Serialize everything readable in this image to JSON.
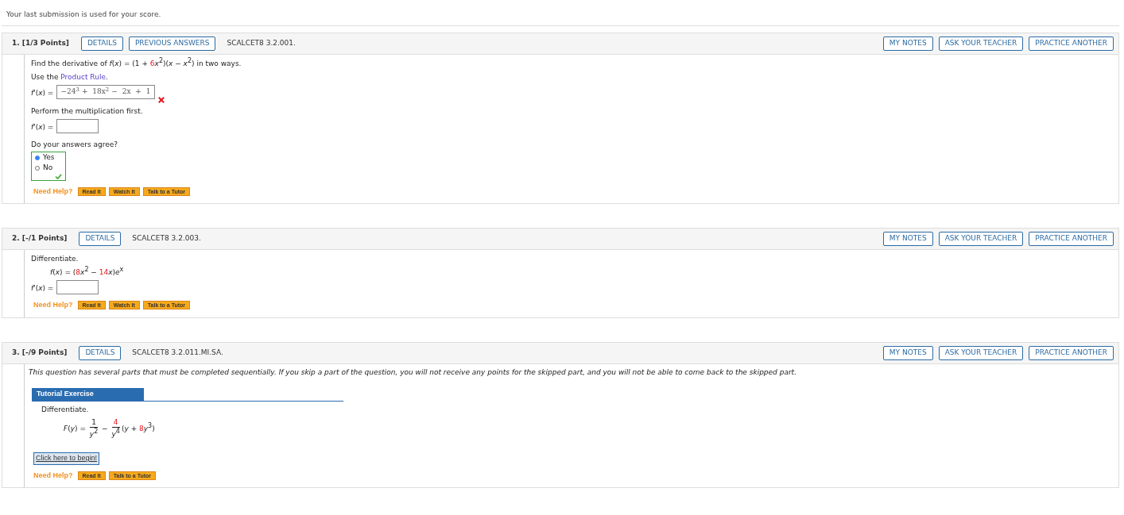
{
  "notice": "Your last submission is used for your score.",
  "questions": [
    {
      "number": "1.",
      "points": "[1/3 Points]",
      "buttons": [
        "DETAILS",
        "PREVIOUS ANSWERS"
      ],
      "code": "SCALCET8 3.2.001.",
      "right_buttons": [
        "MY NOTES",
        "ASK YOUR TEACHER",
        "PRACTICE ANOTHER"
      ],
      "parts": [
        {
          "kind": "text",
          "segments": [
            {
              "kind": "plain",
              "text": "Find the derivative of "
            },
            {
              "kind": "italic",
              "text": "f"
            },
            {
              "kind": "plain",
              "text": "("
            },
            {
              "kind": "italic",
              "text": "x"
            },
            {
              "kind": "plain",
              "text": ") = (1 + "
            },
            {
              "kind": "red",
              "text": "6"
            },
            {
              "kind": "italic",
              "text": "x"
            },
            {
              "kind": "sup",
              "text": "2"
            },
            {
              "kind": "plain",
              "text": ")("
            },
            {
              "kind": "italic",
              "text": "x"
            },
            {
              "kind": "plain",
              "text": " − "
            },
            {
              "kind": "italic",
              "text": "x"
            },
            {
              "kind": "sup",
              "text": "2"
            },
            {
              "kind": "plain",
              "text": ")  in two ways."
            }
          ]
        },
        {
          "kind": "text",
          "segments": [
            {
              "kind": "plain",
              "text": "Use the "
            },
            {
              "kind": "link",
              "text": "Product Rule"
            },
            {
              "kind": "plain",
              "text": "."
            }
          ]
        },
        {
          "kind": "answer",
          "label": [
            {
              "kind": "italic",
              "text": "f'"
            },
            {
              "kind": "plain",
              "text": "("
            },
            {
              "kind": "italic",
              "text": "x"
            },
            {
              "kind": "plain",
              "text": ") ="
            }
          ],
          "value": "−24$^{3}$ + 18x$^{2}$ − 2x + 1",
          "incorrect": true
        },
        {
          "kind": "text",
          "segments": [
            {
              "kind": "plain",
              "text": "Perform the multiplication first."
            }
          ]
        },
        {
          "kind": "answer",
          "label": [
            {
              "kind": "italic",
              "text": "f'"
            },
            {
              "kind": "plain",
              "text": "("
            },
            {
              "kind": "italic",
              "text": "x"
            },
            {
              "kind": "plain",
              "text": ") ="
            }
          ]
        },
        {
          "kind": "radio",
          "question": "Do your answers agree?",
          "options": [
            {
              "label": "Yes",
              "selected": true
            },
            {
              "label": "No",
              "selected": false
            }
          ],
          "correct": true
        }
      ],
      "help": {
        "label": "Need Help?",
        "buttons": [
          "Read It",
          "Watch It",
          "Talk to a Tutor"
        ]
      }
    },
    {
      "number": "2.",
      "points": "[-/1 Points]",
      "buttons": [
        "DETAILS"
      ],
      "code": "SCALCET8 3.2.003.",
      "right_buttons": [
        "MY NOTES",
        "ASK YOUR TEACHER",
        "PRACTICE ANOTHER"
      ],
      "parts": [
        {
          "kind": "text",
          "segments": [
            {
              "kind": "plain",
              "text": "Differentiate."
            }
          ]
        },
        {
          "kind": "math",
          "segments": [
            {
              "kind": "italic",
              "text": "f"
            },
            {
              "kind": "plain",
              "text": "("
            },
            {
              "kind": "italic",
              "text": "x"
            },
            {
              "kind": "plain",
              "text": ") = ("
            },
            {
              "kind": "red",
              "text": "8"
            },
            {
              "kind": "italic",
              "text": "x"
            },
            {
              "kind": "sup",
              "text": "2"
            },
            {
              "kind": "plain",
              "text": " − "
            },
            {
              "kind": "red",
              "text": "14"
            },
            {
              "kind": "italic",
              "text": "x"
            },
            {
              "kind": "plain",
              "text": ")"
            },
            {
              "kind": "italic",
              "text": "e"
            },
            {
              "kind": "sup",
              "text": "x"
            }
          ]
        },
        {
          "kind": "answer",
          "label": [
            {
              "kind": "italic",
              "text": "f'"
            },
            {
              "kind": "plain",
              "text": "("
            },
            {
              "kind": "italic",
              "text": "x"
            },
            {
              "kind": "plain",
              "text": ") ="
            }
          ]
        }
      ],
      "help": {
        "label": "Need Help?",
        "buttons": [
          "Read It",
          "Watch It",
          "Talk to a Tutor"
        ]
      }
    },
    {
      "number": "3.",
      "points": "[-/9 Points]",
      "buttons": [
        "DETAILS"
      ],
      "code": "SCALCET8 3.2.011.MI.SA.",
      "right_buttons": [
        "MY NOTES",
        "ASK YOUR TEACHER",
        "PRACTICE ANOTHER"
      ],
      "parts": [
        {
          "kind": "notice",
          "text": "This question has several parts that must be completed sequentially. If you skip a part of the question, you will not receive any points for the skipped part, and you will not be able to come back to the skipped part."
        },
        {
          "kind": "tutorial",
          "title": "Tutorial Exercise",
          "intro": "Differentiate.",
          "segments": [
            {
              "kind": "italic",
              "text": "F"
            },
            {
              "kind": "plain",
              "text": "("
            },
            {
              "kind": "italic",
              "text": "y"
            },
            {
              "kind": "plain",
              "text": ") = "
            },
            {
              "kind": "frac",
              "num": [
                {
                  "kind": "plain",
                  "text": "1"
                }
              ],
              "den": [
                {
                  "kind": "italic",
                  "text": "y"
                },
                {
                  "kind": "sup",
                  "text": "2"
                }
              ]
            },
            {
              "kind": "plain",
              "text": " − "
            },
            {
              "kind": "frac",
              "num": [
                {
                  "kind": "red",
                  "text": "4"
                }
              ],
              "den": [
                {
                  "kind": "italic",
                  "text": "y"
                },
                {
                  "kind": "sup",
                  "text": "4"
                }
              ]
            },
            {
              "kind": "plain",
              "text": "("
            },
            {
              "kind": "italic",
              "text": "y"
            },
            {
              "kind": "plain",
              "text": " + "
            },
            {
              "kind": "red",
              "text": "8"
            },
            {
              "kind": "italic",
              "text": "y"
            },
            {
              "kind": "sup",
              "text": "3"
            },
            {
              "kind": "plain",
              "text": ")"
            }
          ],
          "button": "Click here to begin!"
        }
      ],
      "help": {
        "label": "Need Help?",
        "buttons": [
          "Read It",
          "Talk to a Tutor"
        ]
      }
    }
  ]
}
